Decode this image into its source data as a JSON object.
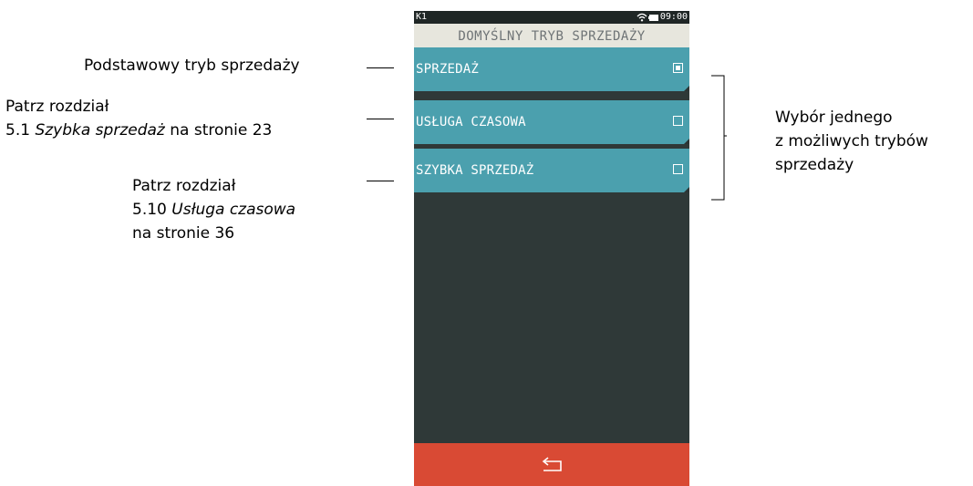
{
  "annotations": {
    "default_mode": "Podstawowy tryb sprzedaży",
    "see_fast_sale": {
      "line1": "Patrz rozdział",
      "prefix": "5.1 ",
      "title": "Szybka sprzedaż",
      "suffix": " na stronie 23"
    },
    "see_time_service": {
      "line1": "Patrz rozdział",
      "prefix": "5.10 ",
      "title": "Usługa czasowa",
      "line3": "na stronie 36"
    },
    "choice": {
      "line1": "Wybór jednego",
      "line2": "z możliwych trybów",
      "line3": "sprzedaży"
    }
  },
  "device": {
    "status_bar": {
      "terminal_id": "K1",
      "time": "09:00",
      "wifi_icon": "wifi-icon",
      "battery_icon": "battery-icon"
    },
    "title": "DOMYŚLNY TRYB SPRZEDAŻY",
    "menu": [
      {
        "label": "SPRZEDAŻ",
        "checked": true
      },
      {
        "label": "USŁUGA CZASOWA",
        "checked": false
      },
      {
        "label": "SZYBKA SPRZEDAŻ",
        "checked": false
      }
    ],
    "back_icon": "back-arrow-icon",
    "colors": {
      "menu_item": "#4ba0ae",
      "background": "#2f3938",
      "title_bar": "#e7e6dd",
      "back_bar": "#d94a34"
    }
  }
}
